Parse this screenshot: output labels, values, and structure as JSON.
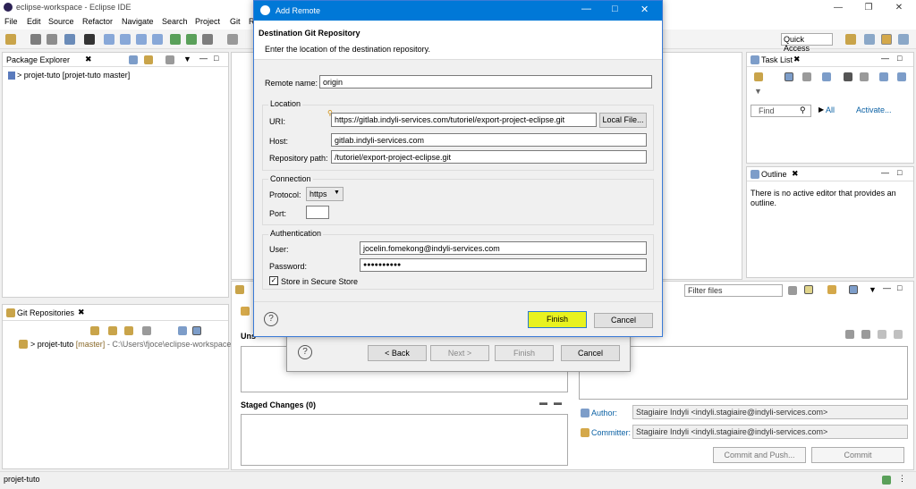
{
  "window": {
    "title": "eclipse-workspace - Eclipse IDE"
  },
  "menubar": {
    "items": [
      "File",
      "Edit",
      "Source",
      "Refactor",
      "Navigate",
      "Search",
      "Project",
      "Git",
      "R"
    ]
  },
  "quick_access": "Quick Access",
  "package_explorer": {
    "tab": "Package Explorer",
    "item": "> projet-tuto [projet-tuto master]"
  },
  "git_repos": {
    "tab": "Git Repositories",
    "item_name": "> projet-tuto",
    "item_branch": "[master]",
    "item_path": "- C:\\Users\\fjoce\\eclipse-workspace"
  },
  "task_list": {
    "tab": "Task List",
    "find_placeholder": "Find",
    "all": "All",
    "activate": "Activate..."
  },
  "outline": {
    "tab": "Outline",
    "message": "There is no active editor that provides an outline."
  },
  "staging": {
    "filter_placeholder": "Filter files",
    "unstaged_label": "Uns",
    "staged_label": "Staged Changes (0)",
    "author_label": "Author:",
    "author_value": "Stagiaire Indyli <indyli.stagiaire@indyli-services.com>",
    "committer_label": "Committer:",
    "committer_value": "Stagiaire Indyli <indyli.stagiaire@indyli-services.com>",
    "commit_push": "Commit and Push...",
    "commit": "Commit"
  },
  "back_dialog": {
    "back": "< Back",
    "next": "Next >",
    "finish": "Finish",
    "cancel": "Cancel"
  },
  "dialog": {
    "title": "Add Remote",
    "heading": "Destination Git Repository",
    "subheading": "Enter the location of the destination repository.",
    "remote_name_label": "Remote name:",
    "remote_name": "origin",
    "location_group": "Location",
    "uri_label": "URI:",
    "uri": "https://gitlab.indyli-services.com/tutoriel/export-project-eclipse.git",
    "local_file": "Local File...",
    "host_label": "Host:",
    "host": "gitlab.indyli-services.com",
    "repo_path_label": "Repository path:",
    "repo_path": "/tutoriel/export-project-eclipse.git",
    "connection_group": "Connection",
    "protocol_label": "Protocol:",
    "protocol": "https",
    "port_label": "Port:",
    "auth_group": "Authentication",
    "user_label": "User:",
    "user": "jocelin.fomekong@indyli-services.com",
    "password_label": "Password:",
    "password": "●●●●●●●●●●",
    "store_label": "Store in Secure Store",
    "finish": "Finish",
    "cancel": "Cancel"
  },
  "status": {
    "text": "projet-tuto"
  },
  "colors": {
    "accent": "#0078d7",
    "highlight": "#e8f21f"
  }
}
